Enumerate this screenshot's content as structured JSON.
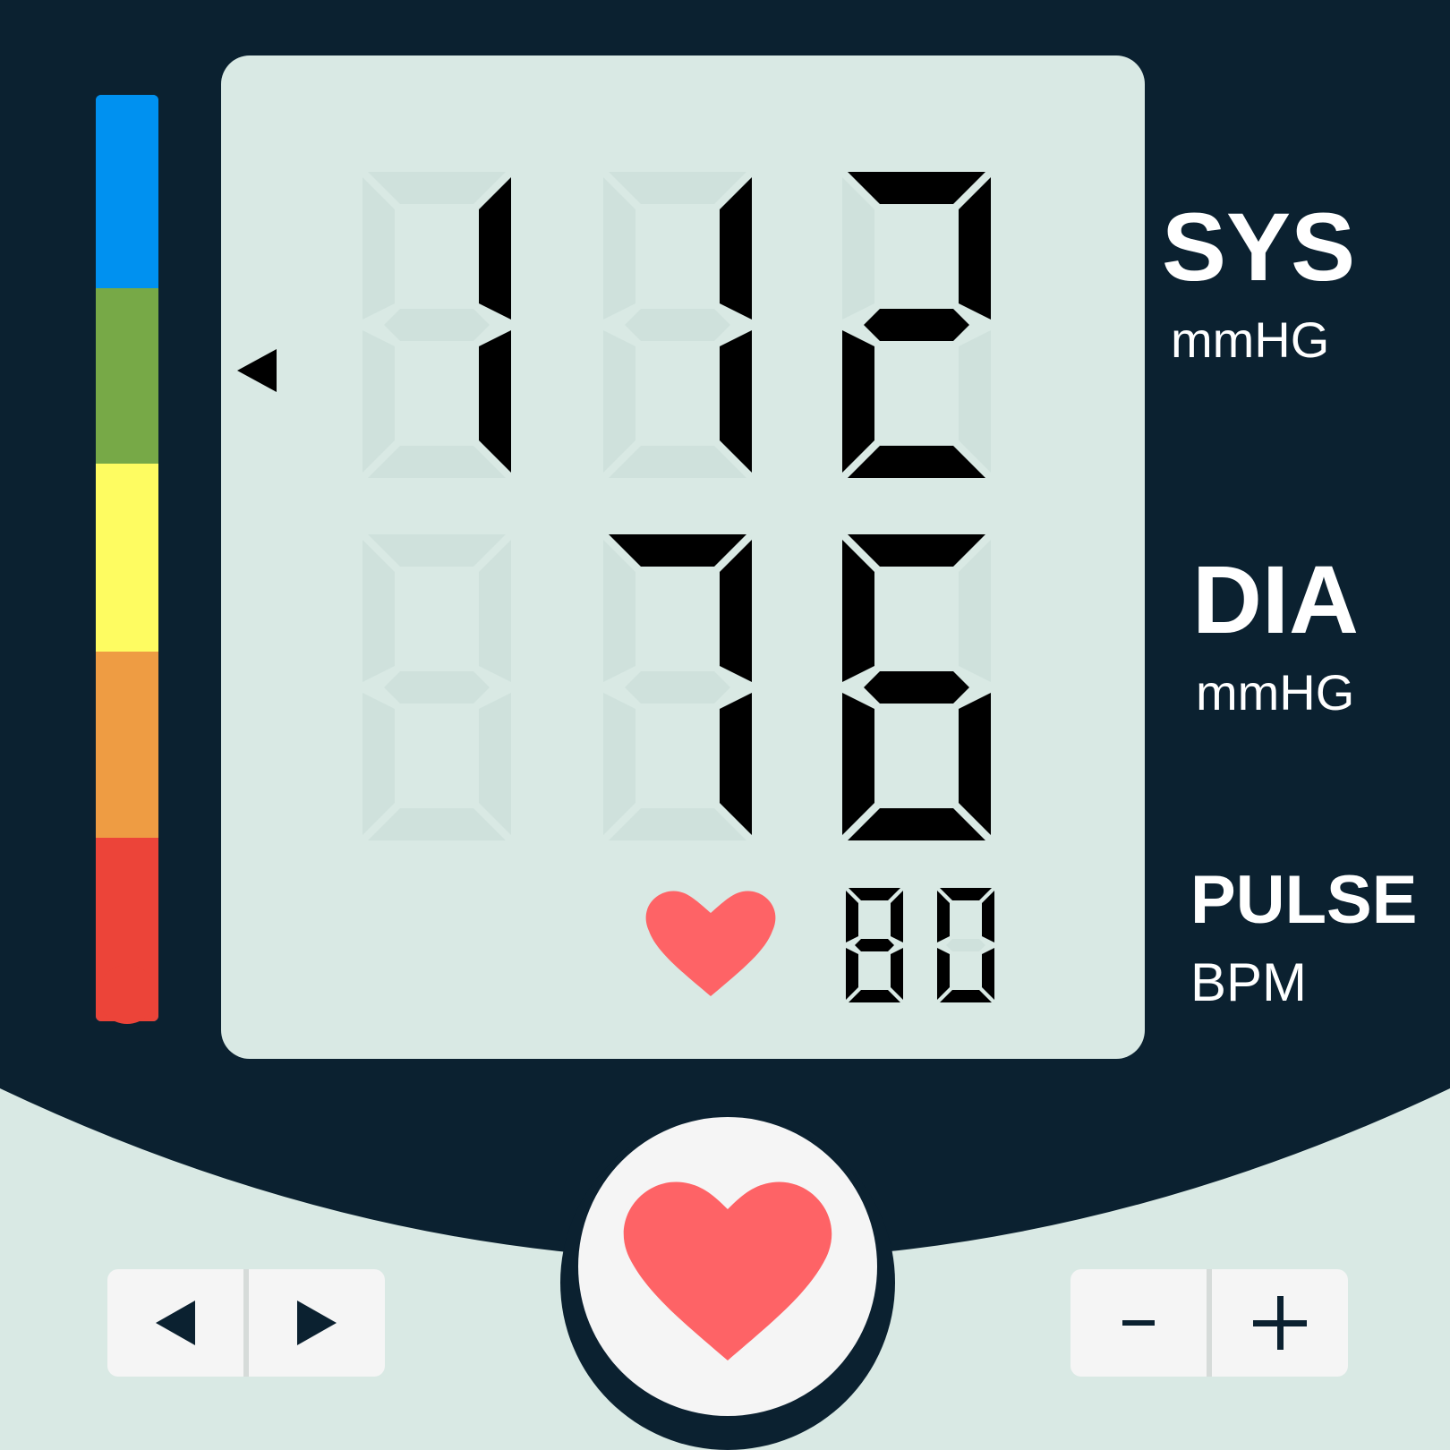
{
  "colors": {
    "housing": "#0b2130",
    "body": "#d9e9e4",
    "screen": "#d9e9e4",
    "segment_on": "#000000",
    "segment_off": "#cfe1dc",
    "heart": "#fe6366",
    "button": "#f5f5f5"
  },
  "level_bar": {
    "segments": [
      {
        "name": "blue",
        "color": "#0091f0"
      },
      {
        "name": "green",
        "color": "#77a947"
      },
      {
        "name": "yellow",
        "color": "#fefc61"
      },
      {
        "name": "orange",
        "color": "#ee9c43"
      },
      {
        "name": "red",
        "color": "#ec4439"
      }
    ]
  },
  "readings": {
    "sys": "112",
    "dia": "76",
    "pulse": "80"
  },
  "labels": {
    "sys": "SYS",
    "sys_unit": "mmHG",
    "dia": "DIA",
    "dia_unit": "mmHG",
    "pulse": "PULSE",
    "pulse_unit": "BPM"
  },
  "controls": {
    "prev_icon": "triangle-left-icon",
    "next_icon": "triangle-right-icon",
    "minus_label": "-",
    "plus_label": "+",
    "measure_icon": "heart-icon"
  }
}
